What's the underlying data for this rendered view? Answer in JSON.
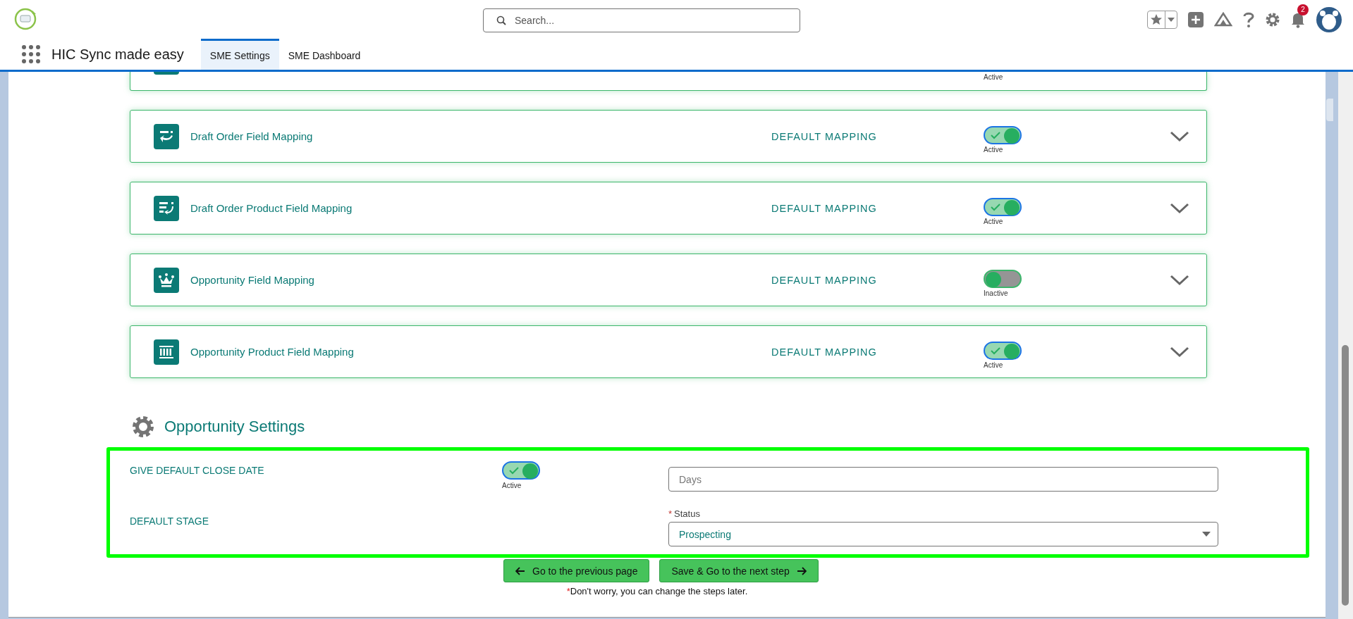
{
  "header": {
    "search": {
      "placeholder": "Search..."
    },
    "notification_count": "2"
  },
  "nav": {
    "app_name": "HIC Sync made easy",
    "tabs": [
      {
        "label": "SME Settings",
        "selected": true
      },
      {
        "label": "SME Dashboard",
        "selected": false
      }
    ]
  },
  "mappings": [
    {
      "kind": "clipped",
      "status_label": "Active"
    },
    {
      "kind": "full",
      "title": "Draft Order Field Mapping",
      "mapping": "DEFAULT MAPPING",
      "active": true,
      "status_label": "Active"
    },
    {
      "kind": "full",
      "title": "Draft Order Product Field Mapping",
      "mapping": "DEFAULT MAPPING",
      "active": true,
      "status_label": "Active"
    },
    {
      "kind": "full",
      "title": "Opportunity Field Mapping",
      "mapping": "DEFAULT MAPPING",
      "active": false,
      "status_label": "Inactive"
    },
    {
      "kind": "full",
      "title": "Opportunity Product Field Mapping",
      "mapping": "DEFAULT MAPPING",
      "active": true,
      "status_label": "Active"
    }
  ],
  "opportunity_settings": {
    "title": "Opportunity Settings",
    "close_date": {
      "label": "GIVE DEFAULT CLOSE DATE",
      "active": true,
      "status_label": "Active",
      "days": {
        "placeholder": "Days"
      }
    },
    "stage": {
      "label": "DEFAULT STAGE",
      "field_label": "Status",
      "required_mark": "*",
      "value": "Prospecting"
    }
  },
  "buttons": [
    {
      "kind": "back",
      "label": "Go to the previous page"
    },
    {
      "kind": "next",
      "label": "Save & Go to the next step"
    }
  ],
  "footnote": {
    "mark": "*",
    "text": "Don't worry, you can change the steps later."
  }
}
